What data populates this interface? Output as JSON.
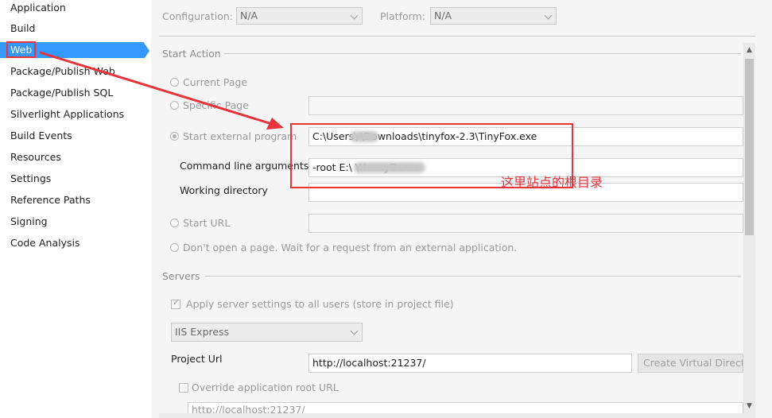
{
  "nav": {
    "items": [
      {
        "label": "Application"
      },
      {
        "label": "Build"
      },
      {
        "label": "Web"
      },
      {
        "label": "Package/Publish Web"
      },
      {
        "label": "Package/Publish SQL"
      },
      {
        "label": "Silverlight Applications"
      },
      {
        "label": "Build Events"
      },
      {
        "label": "Resources"
      },
      {
        "label": "Settings"
      },
      {
        "label": "Reference Paths"
      },
      {
        "label": "Signing"
      },
      {
        "label": "Code Analysis"
      }
    ],
    "selected": "Web"
  },
  "header": {
    "configuration_label": "Configuration:",
    "configuration_value": "N/A",
    "platform_label": "Platform:",
    "platform_value": "N/A"
  },
  "start_action": {
    "title": "Start Action",
    "current_page": "Current Page",
    "specific_page": "Specific Page",
    "start_external_program": "Start external program",
    "external_program_path": "C:\\Users\\        \\Downloads\\tinyfox-2.3\\TinyFox.exe",
    "command_line_label": "Command line arguments",
    "command_line_value": "-root  E:\\                            \\NancyDemo",
    "working_directory_label": "Working directory",
    "start_url": "Start URL",
    "dont_open": "Don't open a page.  Wait for a request from an external application."
  },
  "servers": {
    "title": "Servers",
    "apply_all_users": "Apply server settings to all users (store in project file)",
    "server_type": "IIS Express",
    "project_url_label": "Project Url",
    "project_url_value": "http://localhost:21237/",
    "create_vdir_button": "Create Virtual Directory",
    "override_root_url": "Override application root URL",
    "override_url_value": "http://localhost:21237/"
  },
  "annotation": {
    "text": "这里站点的根目录"
  },
  "colors": {
    "selection": "#3399ff",
    "annotation_red": "#e8323c"
  }
}
